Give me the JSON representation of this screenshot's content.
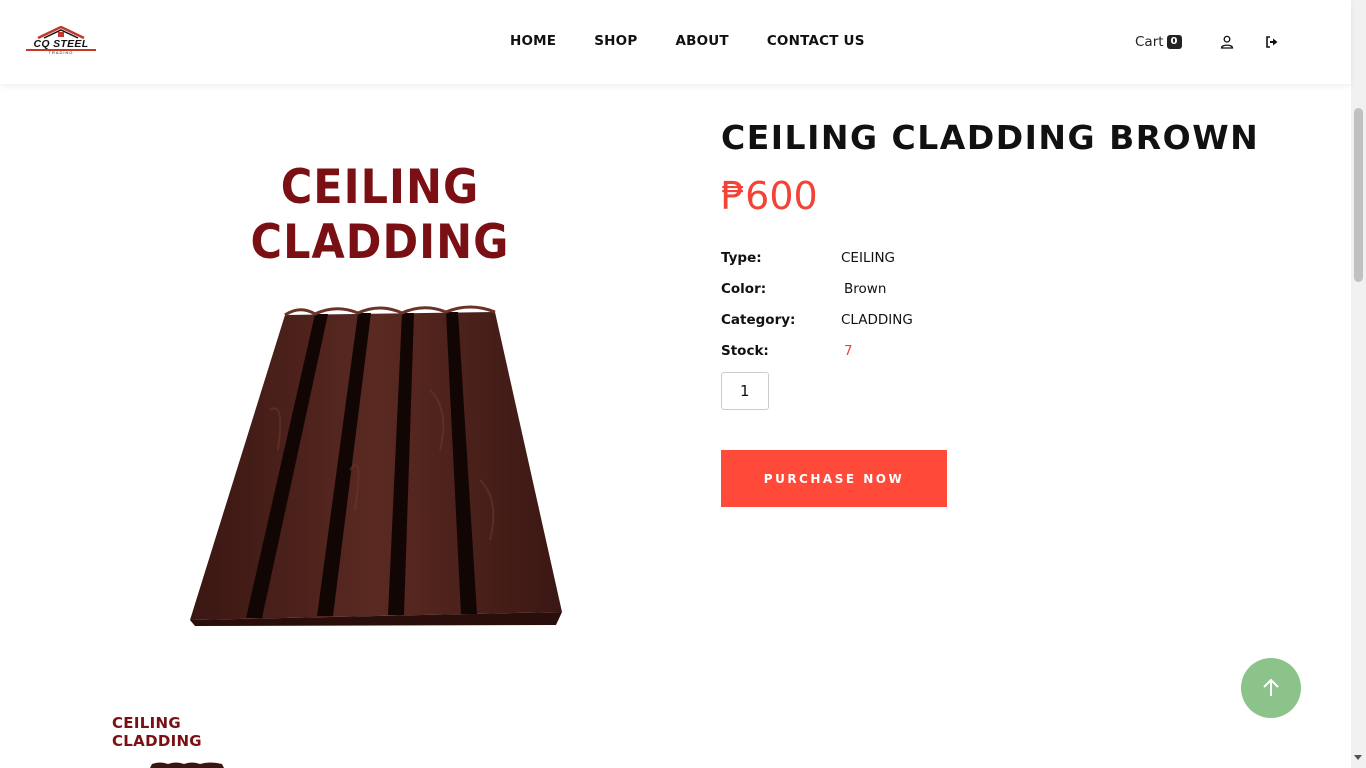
{
  "brand": {
    "logo_text": "CQ STEEL",
    "logo_subtext": "TRADING",
    "colors": {
      "accent": "#ff4a3a",
      "brand_red": "#7a0f14",
      "to_top": "#8bc38b"
    }
  },
  "nav": {
    "items": [
      "HOME",
      "SHOP",
      "ABOUT",
      "CONTACT US"
    ]
  },
  "header": {
    "cart_label": "Cart",
    "cart_count": "0",
    "user_icon": "user-icon",
    "logout_icon": "logout-icon"
  },
  "product": {
    "image_caption": "CEILING CLADDING",
    "thumbnail_caption": "CEILING CLADDING",
    "title": "CEILING CLADDING BROWN",
    "price": "₱600",
    "specs": [
      {
        "key": "Type:",
        "value": "CEILING"
      },
      {
        "key": "Color:",
        "value": "Brown"
      },
      {
        "key": "Category:",
        "value": "CLADDING"
      },
      {
        "key": "Stock:",
        "value": "7"
      }
    ],
    "quantity": "1",
    "purchase_label": "PURCHASE NOW"
  }
}
